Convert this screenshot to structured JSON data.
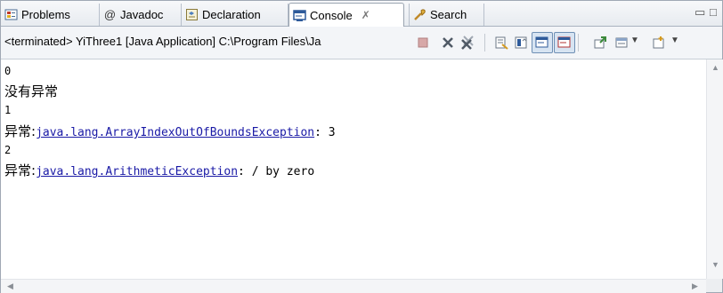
{
  "tabs": [
    {
      "label": "Problems",
      "icon": "problems-icon"
    },
    {
      "label": "Javadoc",
      "icon": "at-icon",
      "glyph": "@"
    },
    {
      "label": "Declaration",
      "icon": "declaration-icon"
    },
    {
      "label": "Console",
      "icon": "console-icon",
      "close": "✗"
    },
    {
      "label": "Search",
      "icon": "search-icon"
    }
  ],
  "toolbar": {
    "status": "<terminated> YiThree1 [Java Application] C:\\Program Files\\Ja"
  },
  "console": {
    "lines": [
      {
        "text": "0"
      },
      {
        "text": "没有异常"
      },
      {
        "text": "1"
      },
      {
        "prefix": "异常:",
        "link": "java.lang.ArrayIndexOutOfBoundsException",
        "suffix": ": 3"
      },
      {
        "text": "2"
      },
      {
        "prefix": "异常:",
        "link": "java.lang.ArithmeticException",
        "suffix": ": / by zero"
      }
    ]
  },
  "colors": {
    "link": "#1a1aa6",
    "active_tab_bg": "#ffffff"
  }
}
